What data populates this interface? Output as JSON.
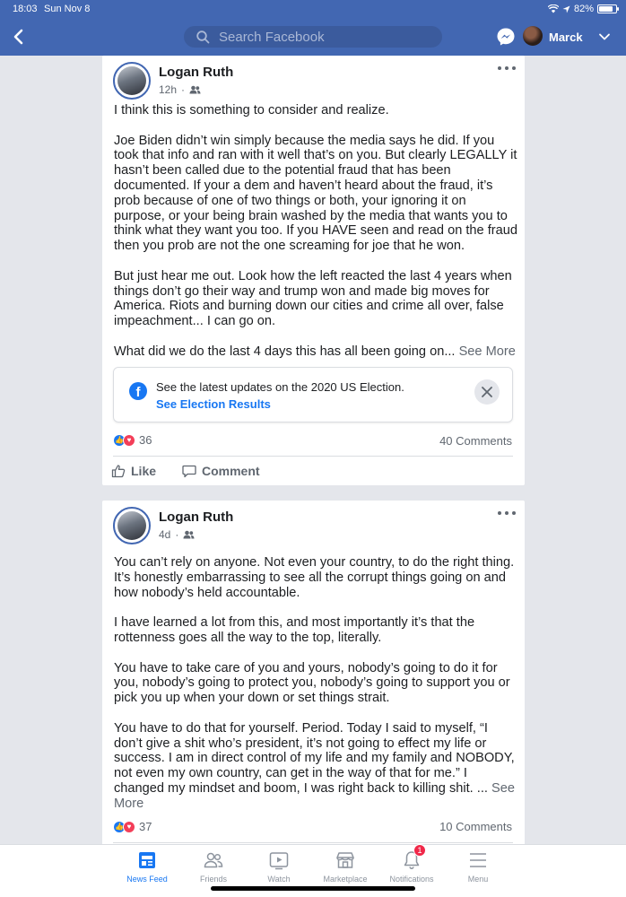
{
  "status_bar": {
    "time": "18:03",
    "date": "Sun Nov 8",
    "battery": "82%",
    "battery_level": 0.82
  },
  "header": {
    "search_placeholder": "Search Facebook",
    "user_name": "Marck",
    "icons": [
      "back-icon",
      "search-icon",
      "messenger-icon",
      "chevron-down-icon"
    ]
  },
  "posts": [
    {
      "author": "Logan Ruth",
      "time": "12h",
      "audience_icon": "friends-icon",
      "paragraphs": [
        "I think this is something to consider and realize.",
        "Joe Biden didn’t win simply because the media says he did. If you took that info and ran with it well that’s on you. But clearly LEGALLY it hasn’t been called due to the potential fraud that has been documented. If your a dem and haven’t heard about the fraud, it’s prob because of one of two things or both, your ignoring it on purpose, or your being brain washed by the media that wants you to think what they want you too. If you HAVE seen and read on the fraud then you prob are not the one screaming for joe that he won.",
        "But just hear me out. Look how the left reacted the last 4 years when things don’t go their way and trump won and made big moves for America. Riots and burning down our cities and crime all over, false impeachment... I can go on."
      ],
      "last_line": "What did we do the last 4 days this has all been going on...",
      "see_more": "See More",
      "election_notice": {
        "text": "See the latest updates on the 2020 US Election.",
        "link": "See Election Results"
      },
      "reaction_count": "36",
      "comments": "40 Comments",
      "like_label": "Like",
      "comment_label": "Comment"
    },
    {
      "author": "Logan Ruth",
      "time": "4d",
      "audience_icon": "friends-icon",
      "paragraphs": [
        "You can’t rely on anyone. Not even your country, to do the right thing. It’s honestly embarrassing to see all the corrupt things going on and how nobody’s held accountable.",
        "I have learned a lot from this, and most importantly it’s that the rottenness goes all the way to the top, literally.",
        "You have to take care of you and yours, nobody’s going to do it for you, nobody’s going to protect you, nobody’s going to support you or pick you up when your down or set things strait."
      ],
      "last_line": "You have to do that for yourself. Period. Today I said to myself, “I don’t give a shit who’s president, it’s not going to effect my life or success. I am in direct control of my life and my family and NOBODY, not even my own country, can get in the way of that for me.” I changed my mindset and boom, I was right back to killing shit. ...",
      "see_more": "See More",
      "reaction_count": "37",
      "comments": "10 Comments"
    }
  ],
  "tabbar": {
    "items": [
      {
        "label": "News Feed",
        "icon": "news-feed-icon",
        "active": true
      },
      {
        "label": "Friends",
        "icon": "friends-icon"
      },
      {
        "label": "Watch",
        "icon": "watch-icon"
      },
      {
        "label": "Marketplace",
        "icon": "marketplace-icon"
      },
      {
        "label": "Notifications",
        "icon": "bell-icon",
        "badge": "1"
      },
      {
        "label": "Menu",
        "icon": "menu-icon"
      }
    ]
  },
  "colors": {
    "header": "#4267b2",
    "link": "#1877f2",
    "like": "#1877f2",
    "love": "#f33e58",
    "badge": "#f02849"
  }
}
